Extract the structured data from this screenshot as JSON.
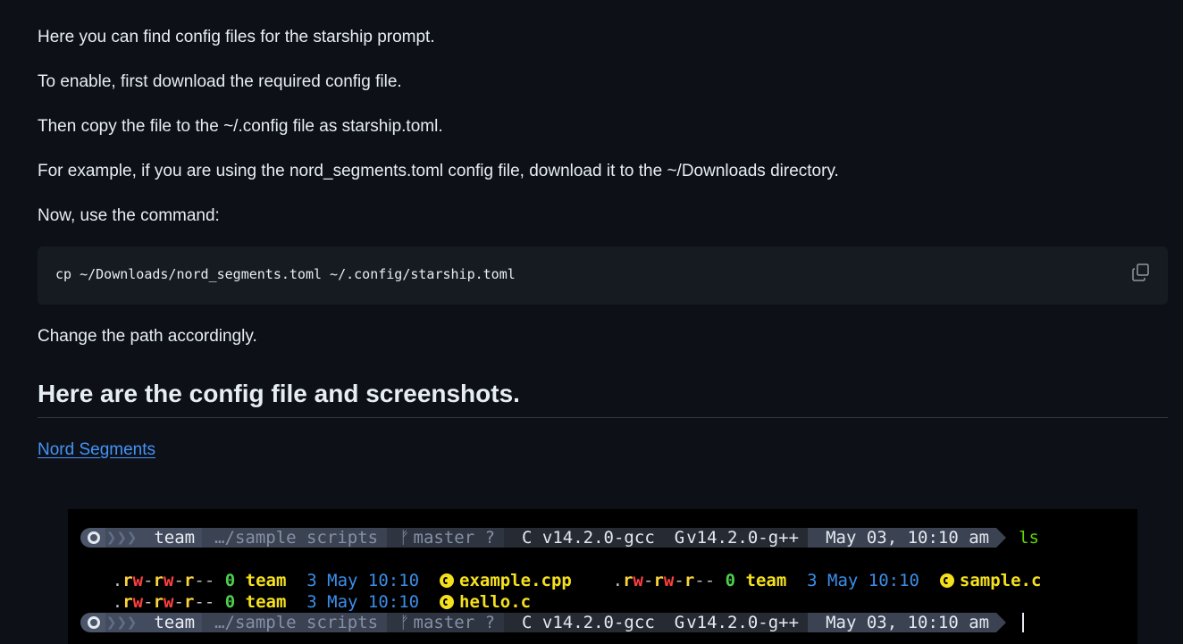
{
  "doc": {
    "paragraphs": [
      "Here you can find config files for the starship prompt.",
      "To enable, first download the required config file.",
      "Then copy the file to the ~/.config file as starship.toml.",
      "For example, if you are using the nord_segments.toml config file, download it to the ~/Downloads directory.",
      "Now, use the command:"
    ],
    "code": "cp ~/Downloads/nord_segments.toml ~/.config/starship.toml",
    "after_code": "Change the path accordingly.",
    "heading": "Here are the config file and screenshots.",
    "link": "Nord Segments"
  },
  "terminal": {
    "prompt": {
      "user": "team",
      "dir": "…/sample scripts",
      "git_branch": "master ?",
      "c_version": "C v14.2.0-gcc",
      "cpp_version": "v14.2.0-g++",
      "time": "May 03, 10:10 am"
    },
    "command": "ls",
    "entries": [
      {
        "perm_dot": ".",
        "owner": "team",
        "size": "0",
        "date": "3 May 10:10",
        "name": "example.cpp"
      },
      {
        "perm_dot": ".",
        "owner": "team",
        "size": "0",
        "date": "3 May 10:10",
        "name": "sample.c"
      },
      {
        "perm_dot": ".",
        "owner": "team",
        "size": "0",
        "date": "3 May 10:10",
        "name": "hello.c"
      }
    ]
  },
  "colors": {
    "background": "#0d1117",
    "link": "#4493f8",
    "code_bg": "#161b22"
  }
}
